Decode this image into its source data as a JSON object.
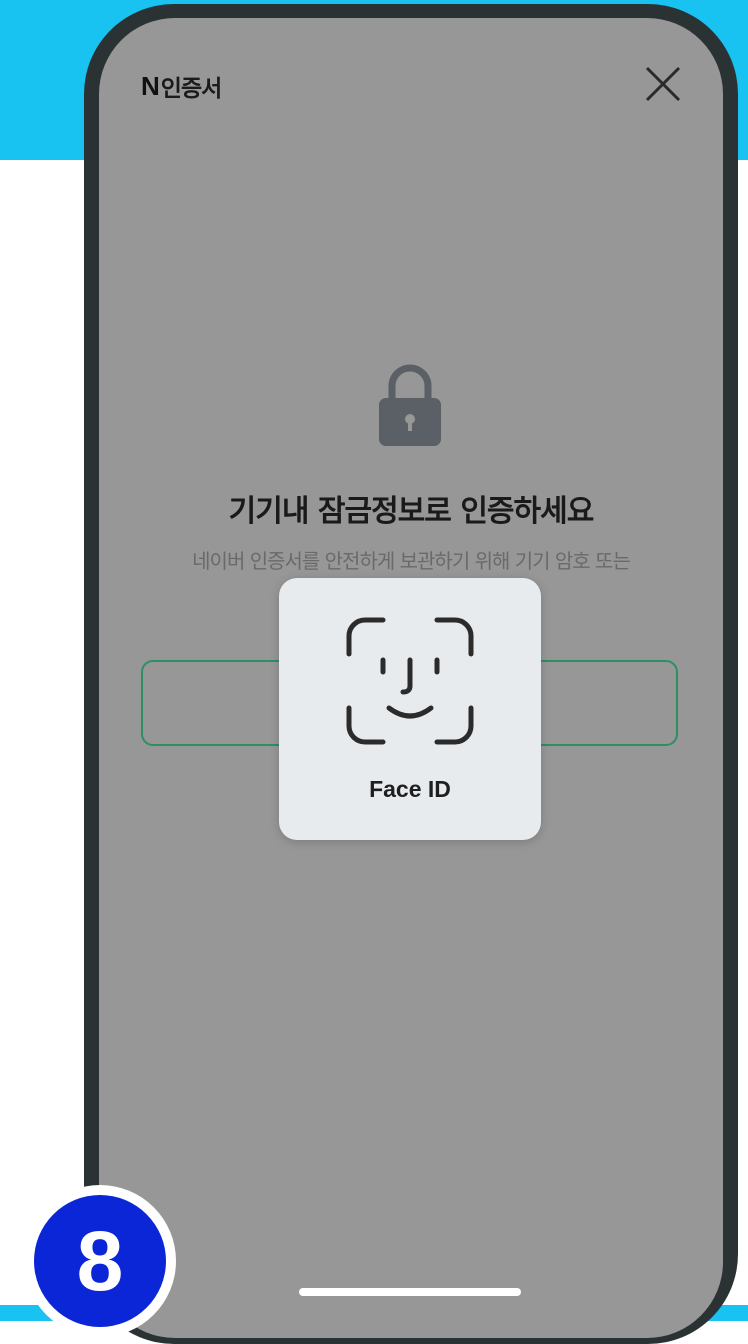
{
  "header": {
    "brand_mark": "N",
    "brand_title": "인증서"
  },
  "auth": {
    "headline": "기기내 잠금정보로 인증하세요",
    "description": "네이버 인증서를 안전하게 보관하기 위해 기기 암호 또는"
  },
  "face_id": {
    "label": "Face ID"
  },
  "step": {
    "number": "8"
  },
  "icons": {
    "close": "close-icon",
    "lock": "lock-icon",
    "face_id": "face-id-icon"
  },
  "colors": {
    "band": "#19c3f1",
    "badge": "#0b26d6",
    "button_border": "#2d8f63",
    "screen_dim": "#979797"
  }
}
